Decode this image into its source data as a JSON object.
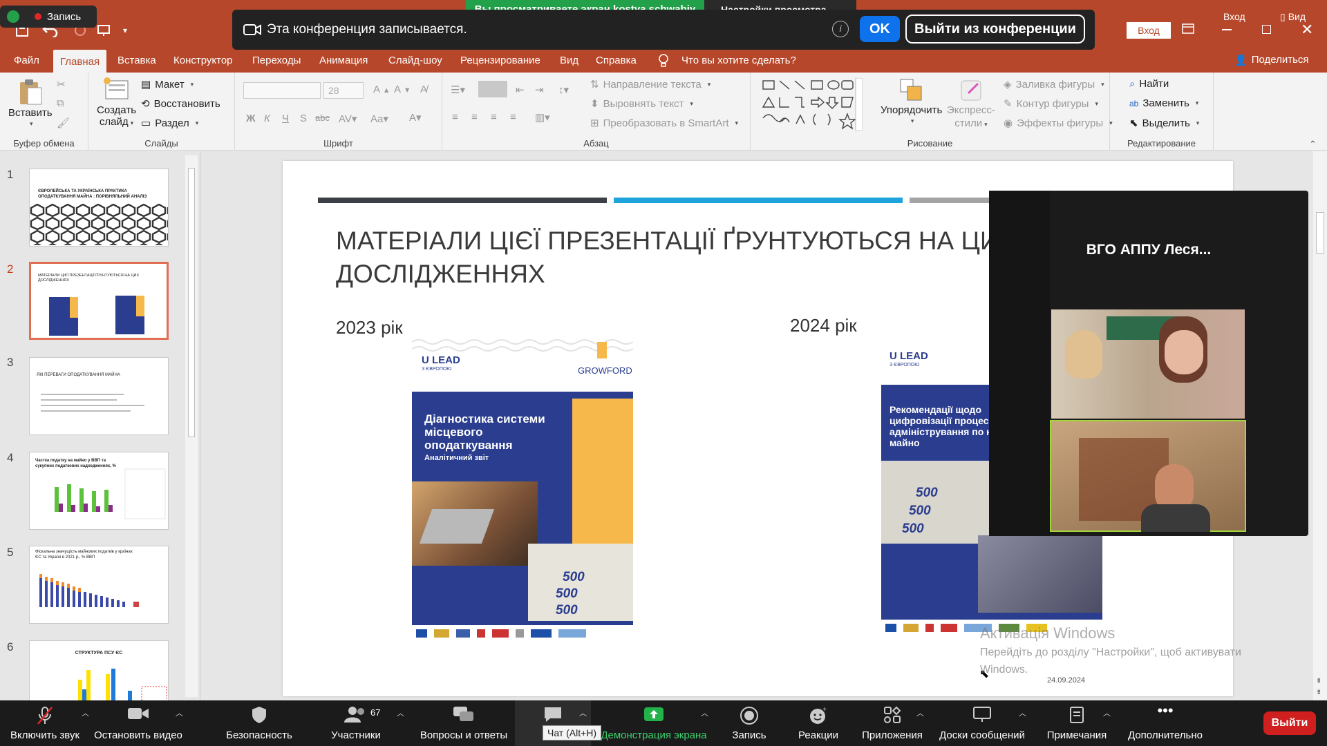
{
  "zoom": {
    "recording_badge": "Запись",
    "viewing_banner": "Вы просматриваете экран kostya schwabiy",
    "view_options": "Настройки просмотра",
    "recording_notice": "Эта конференция записывается.",
    "ok": "OK",
    "leave": "Выйти из конференции",
    "toolbar": [
      {
        "label": "Включить звук",
        "icon": "microphone-muted-icon"
      },
      {
        "label": "Остановить видео",
        "icon": "video-camera-icon"
      },
      {
        "label": "Безопасность",
        "icon": "shield-icon"
      },
      {
        "label": "Участники",
        "icon": "participants-icon",
        "count": "67"
      },
      {
        "label": "Вопросы и ответы",
        "icon": "qa-icon"
      },
      {
        "label": "Чат",
        "icon": "chat-icon"
      },
      {
        "label": "Демонстрация экрана",
        "icon": "share-screen-icon"
      },
      {
        "label": "Запись",
        "icon": "record-icon"
      },
      {
        "label": "Реакции",
        "icon": "reaction-icon"
      },
      {
        "label": "Приложения",
        "icon": "apps-icon"
      },
      {
        "label": "Доски сообщений",
        "icon": "whiteboard-icon"
      },
      {
        "label": "Примечания",
        "icon": "notes-icon"
      },
      {
        "label": "Дополнительно",
        "icon": "more-icon"
      }
    ],
    "chat_tooltip": "Чат (Alt+H)",
    "end": "Выйти",
    "video": {
      "participant_name": "ВГО АППУ Леся..."
    }
  },
  "ppt": {
    "title_right": {
      "signin": "Вход",
      "view": "Вид",
      "signin_btn": "Вход"
    },
    "tabs": [
      "Файл",
      "Главная",
      "Вставка",
      "Конструктор",
      "Переходы",
      "Анимация",
      "Слайд-шоу",
      "Рецензирование",
      "Вид",
      "Справка"
    ],
    "tell_me": "Что вы хотите сделать?",
    "share": "Поделиться",
    "ribbon": {
      "paste": "Вставить",
      "clipboard": "Буфер обмена",
      "new_slide_1": "Создать",
      "new_slide_2": "слайд",
      "layout": "Макет",
      "reset": "Восстановить",
      "section": "Раздел",
      "slides": "Слайды",
      "font_size": "28",
      "font": "Шрифт",
      "bold": "Ж",
      "italic": "К",
      "underline": "Ч",
      "shadow": "S",
      "strike": "abc",
      "text_direction": "Направление текста",
      "align_text": "Выровнять текст",
      "convert_smartart": "Преобразовать в SmartArt",
      "paragraph": "Абзац",
      "arrange": "Упорядочить",
      "quick_styles_1": "Экспресс-",
      "quick_styles_2": "стили",
      "shape_fill": "Заливка фигуры",
      "shape_outline": "Контур фигуры",
      "shape_effects": "Эффекты фигуры",
      "drawing": "Рисование",
      "find": "Найти",
      "replace": "Заменить",
      "select": "Выделить",
      "editing": "Редактирование"
    },
    "thumbs": [
      {
        "num": "1",
        "title": "ЄВРОПЕЙСЬКА ТА УКРАЇНСЬКА ПРАКТИКА ОПОДАТКУВАННЯ МАЙНА : ПОРІВНЯЛЬНИЙ АНАЛІЗ"
      },
      {
        "num": "2",
        "title": "МАТЕРІАЛИ ЦІЄЇ ПРЕЗЕНТАЦІЇ ҐРУНТУЮТЬСЯ НА ЦИХ ДОСЛІДЖЕННЯХ"
      },
      {
        "num": "3",
        "title": "ЯКІ ПЕРЕВАГИ ОПОДАТКУВАННЯ МАЙНА"
      },
      {
        "num": "4",
        "title": "Частка податку на майно у ВВП та сукупних податкових надходженнях, %"
      },
      {
        "num": "5",
        "title": "Фіскальна значущість майнових податків у країнах ЄС та Україні в 2021 р., % ВВП"
      },
      {
        "num": "6",
        "title": "СТРУКТУРА ПСУ ЄС"
      }
    ],
    "slide": {
      "title": "МАТЕРІАЛИ ЦІЄЇ ПРЕЗЕНТАЦІЇ ҐРУНТУЮТЬСЯ НА ЦИХ ДОСЛІДЖЕННЯХ",
      "year_left": "2023 рік",
      "year_right": "2024 рік",
      "cover_left": {
        "ulead": "U LEAD",
        "sub": "З ЄВРОПОЮ",
        "growford": "GROWFORD",
        "title": "Діагностика системи місцевого оподаткування",
        "subtitle": "Аналітичний звіт"
      },
      "cover_right": {
        "ulead": "U LEAD",
        "sub": "З ЄВРОПОЮ",
        "title": "Рекомендації щодо цифровізації процес адміністрування по на майно"
      },
      "banknote": "500",
      "date": "24.09.2024",
      "watermark_1": "Активація Windows",
      "watermark_2": "Перейдіть до розділу \"Настройки\", щоб активувати",
      "watermark_3": "Windows."
    },
    "colors": {
      "brand": "#b7472a",
      "accent_blue": "#1fa3dc",
      "cover_blue": "#2a3d8f",
      "cover_orange": "#f7b84b"
    }
  }
}
